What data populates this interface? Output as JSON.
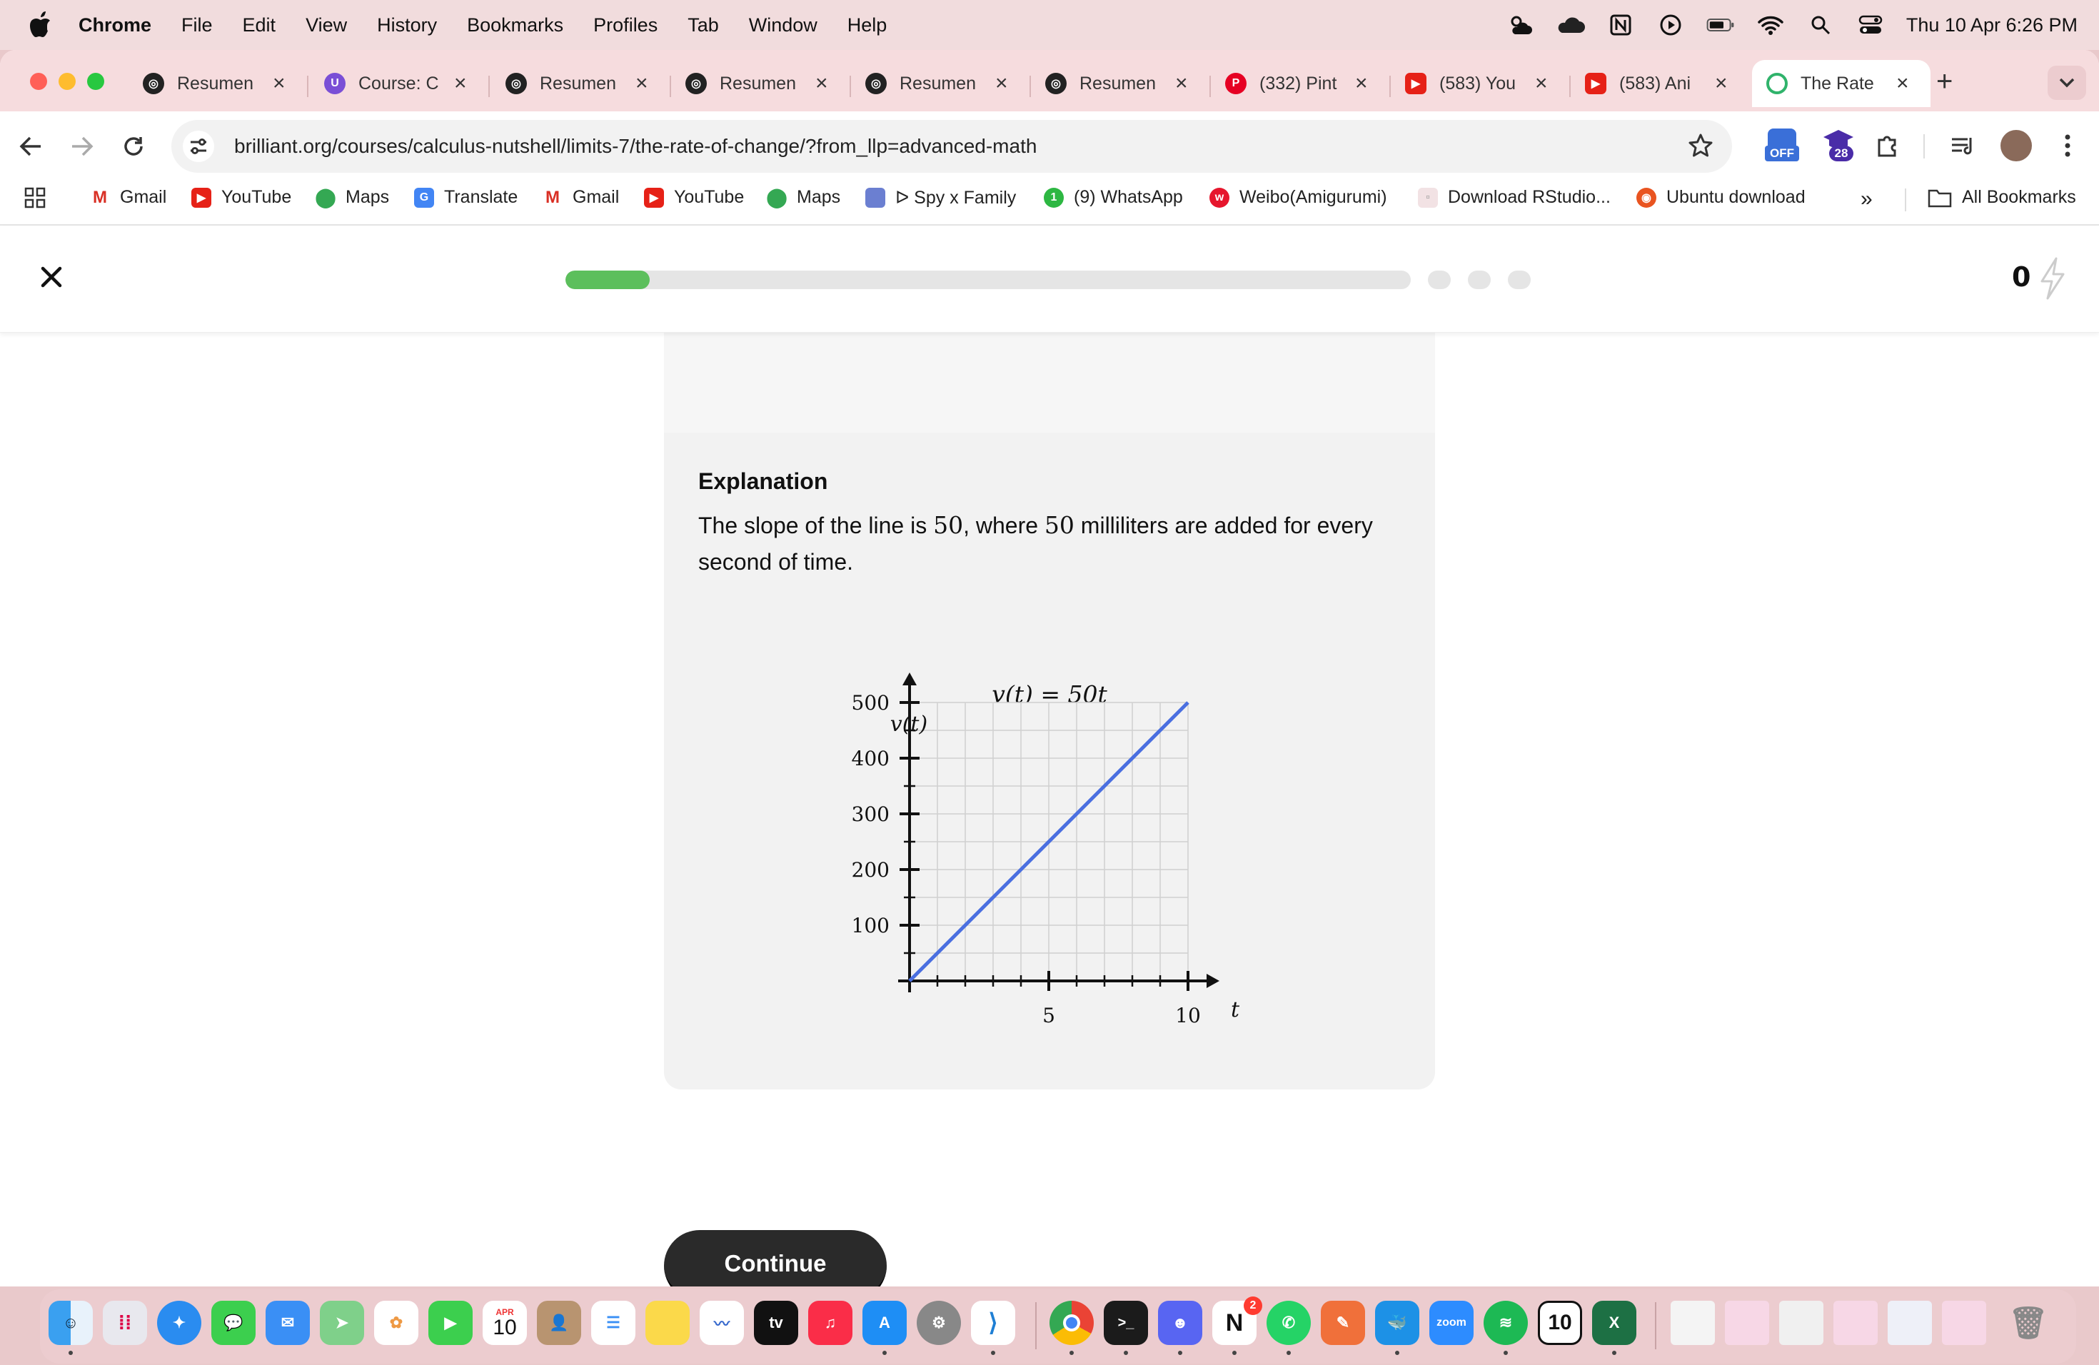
{
  "menubar": {
    "app_name": "Chrome",
    "items": [
      "File",
      "Edit",
      "View",
      "History",
      "Bookmarks",
      "Profiles",
      "Tab",
      "Window",
      "Help"
    ],
    "clock": "Thu 10 Apr  6:26 PM"
  },
  "tabs": [
    {
      "title": "Resumen",
      "icon": "openai-icon"
    },
    {
      "title": "Course: C",
      "icon": "course-icon"
    },
    {
      "title": "Resumen",
      "icon": "openai-icon"
    },
    {
      "title": "Resumen",
      "icon": "openai-icon"
    },
    {
      "title": "Resumen",
      "icon": "openai-icon"
    },
    {
      "title": "Resumen",
      "icon": "openai-icon"
    },
    {
      "title": "(332) Pint",
      "icon": "pinterest-icon"
    },
    {
      "title": "(583) You",
      "icon": "youtube-icon"
    },
    {
      "title": "(583) Ani",
      "icon": "youtube-icon"
    },
    {
      "title": "The Rate",
      "icon": "brilliant-icon",
      "active": true
    }
  ],
  "omnibox": {
    "url": "brilliant.org/courses/calculus-nutshell/limits-7/the-rate-of-change/?from_llp=advanced-math"
  },
  "extensions": {
    "badge_off": "OFF",
    "badge_count": "28"
  },
  "bookmarks": [
    {
      "label": "Gmail",
      "icon": "gmail-icon"
    },
    {
      "label": "YouTube",
      "icon": "youtube-icon"
    },
    {
      "label": "Maps",
      "icon": "maps-icon"
    },
    {
      "label": "Translate",
      "icon": "translate-icon"
    },
    {
      "label": "Gmail",
      "icon": "gmail-icon"
    },
    {
      "label": "YouTube",
      "icon": "youtube-icon"
    },
    {
      "label": "Maps",
      "icon": "maps-icon"
    },
    {
      "label": "ᐅ Spy x Family",
      "icon": "spy-icon"
    },
    {
      "label": "(9) WhatsApp",
      "icon": "whatsapp-icon"
    },
    {
      "label": "Weibo(Amigurumi)",
      "icon": "weibo-icon"
    },
    {
      "label": "Download RStudio...",
      "icon": "rstudio-icon"
    },
    {
      "label": "Ubuntu download",
      "icon": "ubuntu-icon"
    }
  ],
  "bookmarks_more": "»",
  "all_bookmarks": "All Bookmarks",
  "lesson": {
    "progress": 0.1,
    "score": "0",
    "explanation_title": "Explanation",
    "explanation_line1_a": "The slope of the line is ",
    "explanation_line1_m1": "50",
    "explanation_line1_b": ", where ",
    "explanation_line1_m2": "50",
    "explanation_line1_c": " milliliters are added for every second of time.",
    "continue_label": "Continue"
  },
  "chart_data": {
    "type": "line",
    "title": "v(t) = 50t",
    "xlabel": "t",
    "ylabel": "v(t)",
    "xlim": [
      0,
      10
    ],
    "ylim": [
      0,
      500
    ],
    "x_ticks": [
      5,
      10
    ],
    "y_ticks": [
      100,
      200,
      300,
      400,
      500
    ],
    "grid": true,
    "series": [
      {
        "color": "#4a6fe0",
        "x": [
          0,
          10
        ],
        "y": [
          0,
          500
        ]
      }
    ]
  },
  "dock": {
    "calendar_month": "APR",
    "calendar_day": "10",
    "notion_badge": "2",
    "zoom_label": "zoom",
    "tv_label": "tv"
  }
}
